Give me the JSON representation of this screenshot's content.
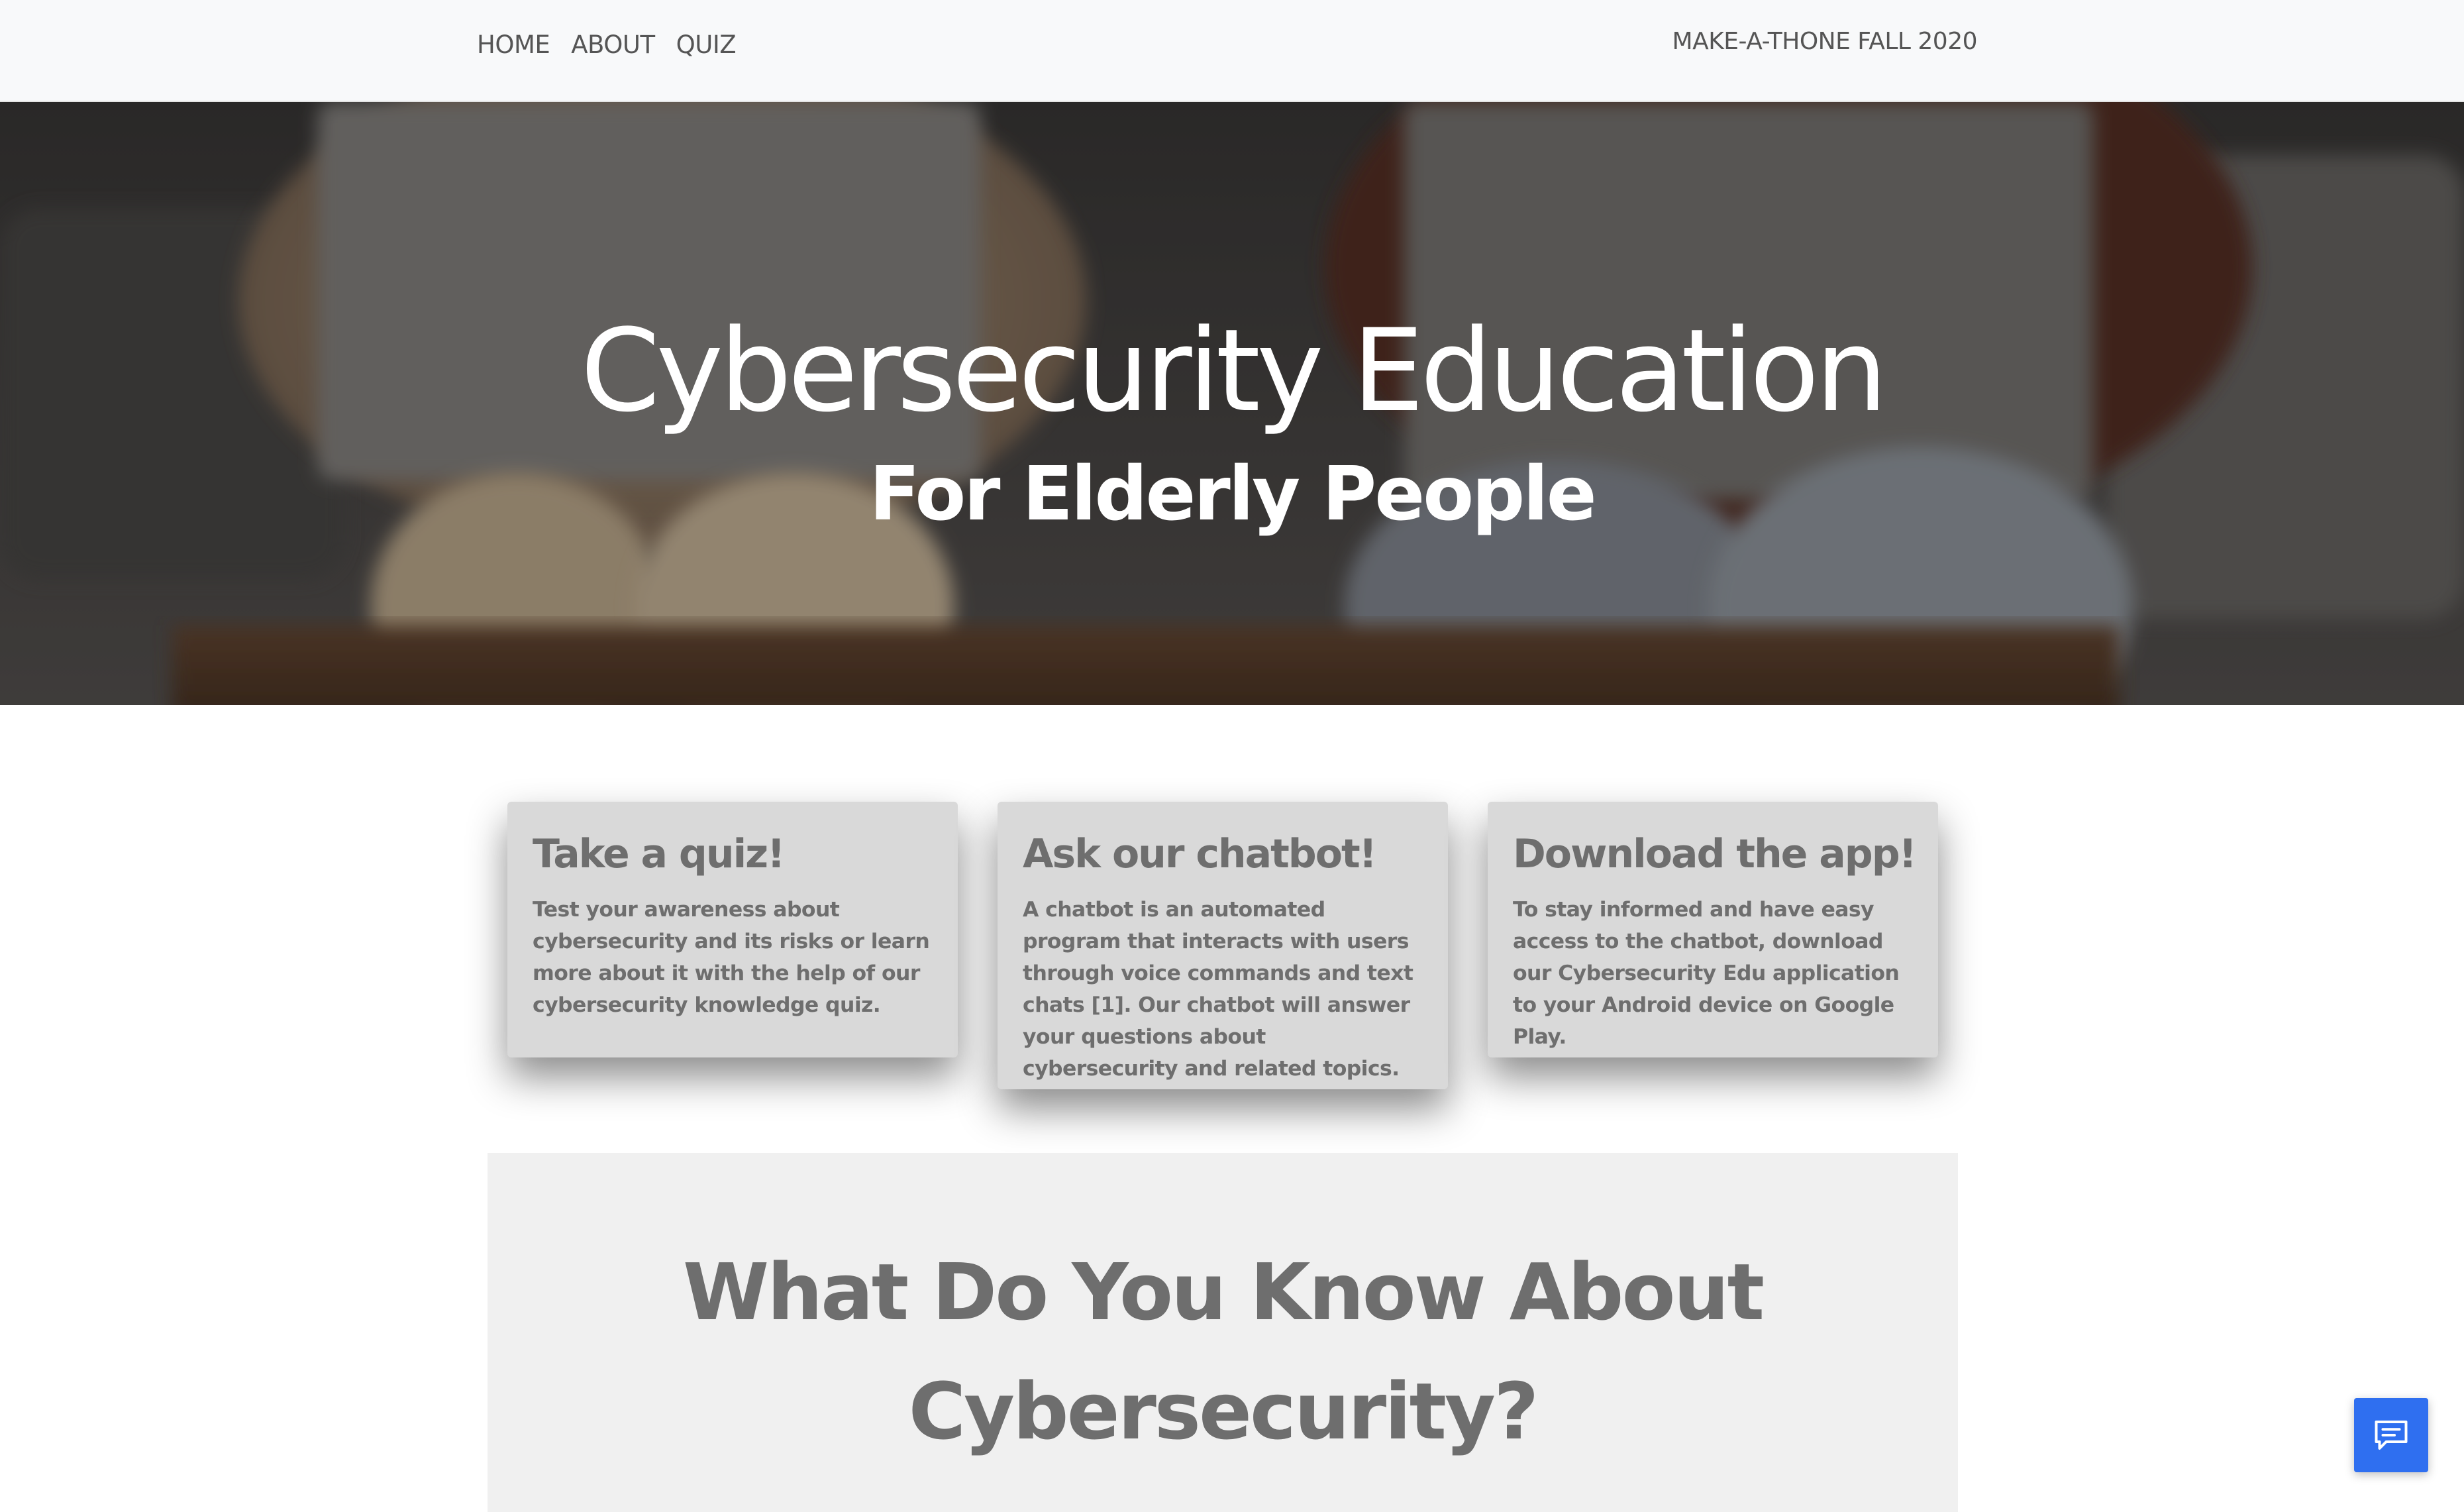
{
  "nav": {
    "links": [
      "HOME",
      "ABOUT",
      "QUIZ"
    ],
    "brand": "MAKE-A-THONE FALL 2020"
  },
  "hero": {
    "title": "Cybersecurity Education",
    "subtitle": "For Elderly People"
  },
  "cards": [
    {
      "title": "Take a quiz!",
      "text": "Test your awareness about cybersecurity and its risks or learn more about it with the help of our cybersecurity knowledge quiz."
    },
    {
      "title": "Ask our chatbot!",
      "text": "A chatbot is an automated program that interacts with users through voice commands and text chats [1]. Our chatbot will answer your questions about cybersecurity and related topics."
    },
    {
      "title": "Download the app!",
      "text": "To stay informed and have easy access to the chatbot, download our Cybersecurity Edu application to your Android device on Google Play."
    }
  ],
  "quiz_section": {
    "heading": "What Do You Know About Cybersecurity?"
  },
  "chat_widget": {
    "icon": "chat-bubble-icon",
    "color": "#2f6ff0"
  }
}
